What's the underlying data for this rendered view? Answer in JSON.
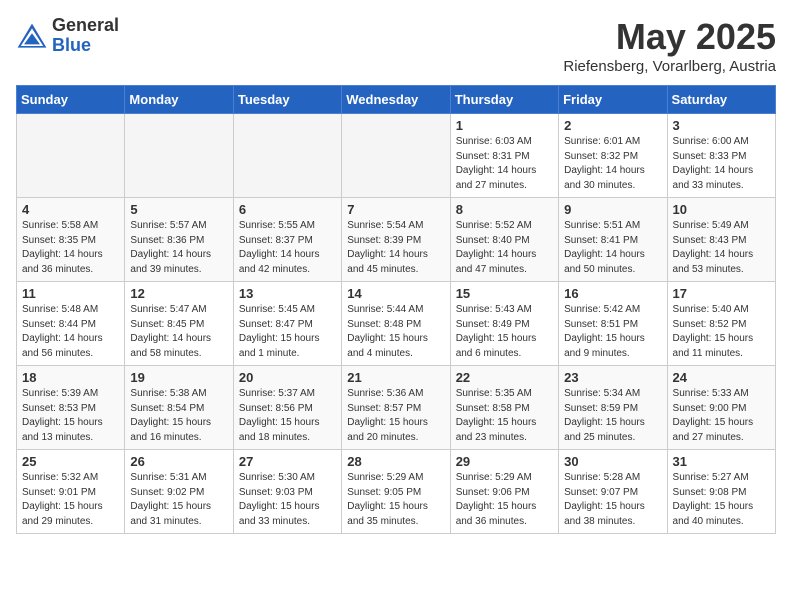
{
  "header": {
    "logo_general": "General",
    "logo_blue": "Blue",
    "title": "May 2025",
    "location": "Riefensberg, Vorarlberg, Austria"
  },
  "weekdays": [
    "Sunday",
    "Monday",
    "Tuesday",
    "Wednesday",
    "Thursday",
    "Friday",
    "Saturday"
  ],
  "weeks": [
    [
      {
        "day": "",
        "info": ""
      },
      {
        "day": "",
        "info": ""
      },
      {
        "day": "",
        "info": ""
      },
      {
        "day": "",
        "info": ""
      },
      {
        "day": "1",
        "info": "Sunrise: 6:03 AM\nSunset: 8:31 PM\nDaylight: 14 hours\nand 27 minutes."
      },
      {
        "day": "2",
        "info": "Sunrise: 6:01 AM\nSunset: 8:32 PM\nDaylight: 14 hours\nand 30 minutes."
      },
      {
        "day": "3",
        "info": "Sunrise: 6:00 AM\nSunset: 8:33 PM\nDaylight: 14 hours\nand 33 minutes."
      }
    ],
    [
      {
        "day": "4",
        "info": "Sunrise: 5:58 AM\nSunset: 8:35 PM\nDaylight: 14 hours\nand 36 minutes."
      },
      {
        "day": "5",
        "info": "Sunrise: 5:57 AM\nSunset: 8:36 PM\nDaylight: 14 hours\nand 39 minutes."
      },
      {
        "day": "6",
        "info": "Sunrise: 5:55 AM\nSunset: 8:37 PM\nDaylight: 14 hours\nand 42 minutes."
      },
      {
        "day": "7",
        "info": "Sunrise: 5:54 AM\nSunset: 8:39 PM\nDaylight: 14 hours\nand 45 minutes."
      },
      {
        "day": "8",
        "info": "Sunrise: 5:52 AM\nSunset: 8:40 PM\nDaylight: 14 hours\nand 47 minutes."
      },
      {
        "day": "9",
        "info": "Sunrise: 5:51 AM\nSunset: 8:41 PM\nDaylight: 14 hours\nand 50 minutes."
      },
      {
        "day": "10",
        "info": "Sunrise: 5:49 AM\nSunset: 8:43 PM\nDaylight: 14 hours\nand 53 minutes."
      }
    ],
    [
      {
        "day": "11",
        "info": "Sunrise: 5:48 AM\nSunset: 8:44 PM\nDaylight: 14 hours\nand 56 minutes."
      },
      {
        "day": "12",
        "info": "Sunrise: 5:47 AM\nSunset: 8:45 PM\nDaylight: 14 hours\nand 58 minutes."
      },
      {
        "day": "13",
        "info": "Sunrise: 5:45 AM\nSunset: 8:47 PM\nDaylight: 15 hours\nand 1 minute."
      },
      {
        "day": "14",
        "info": "Sunrise: 5:44 AM\nSunset: 8:48 PM\nDaylight: 15 hours\nand 4 minutes."
      },
      {
        "day": "15",
        "info": "Sunrise: 5:43 AM\nSunset: 8:49 PM\nDaylight: 15 hours\nand 6 minutes."
      },
      {
        "day": "16",
        "info": "Sunrise: 5:42 AM\nSunset: 8:51 PM\nDaylight: 15 hours\nand 9 minutes."
      },
      {
        "day": "17",
        "info": "Sunrise: 5:40 AM\nSunset: 8:52 PM\nDaylight: 15 hours\nand 11 minutes."
      }
    ],
    [
      {
        "day": "18",
        "info": "Sunrise: 5:39 AM\nSunset: 8:53 PM\nDaylight: 15 hours\nand 13 minutes."
      },
      {
        "day": "19",
        "info": "Sunrise: 5:38 AM\nSunset: 8:54 PM\nDaylight: 15 hours\nand 16 minutes."
      },
      {
        "day": "20",
        "info": "Sunrise: 5:37 AM\nSunset: 8:56 PM\nDaylight: 15 hours\nand 18 minutes."
      },
      {
        "day": "21",
        "info": "Sunrise: 5:36 AM\nSunset: 8:57 PM\nDaylight: 15 hours\nand 20 minutes."
      },
      {
        "day": "22",
        "info": "Sunrise: 5:35 AM\nSunset: 8:58 PM\nDaylight: 15 hours\nand 23 minutes."
      },
      {
        "day": "23",
        "info": "Sunrise: 5:34 AM\nSunset: 8:59 PM\nDaylight: 15 hours\nand 25 minutes."
      },
      {
        "day": "24",
        "info": "Sunrise: 5:33 AM\nSunset: 9:00 PM\nDaylight: 15 hours\nand 27 minutes."
      }
    ],
    [
      {
        "day": "25",
        "info": "Sunrise: 5:32 AM\nSunset: 9:01 PM\nDaylight: 15 hours\nand 29 minutes."
      },
      {
        "day": "26",
        "info": "Sunrise: 5:31 AM\nSunset: 9:02 PM\nDaylight: 15 hours\nand 31 minutes."
      },
      {
        "day": "27",
        "info": "Sunrise: 5:30 AM\nSunset: 9:03 PM\nDaylight: 15 hours\nand 33 minutes."
      },
      {
        "day": "28",
        "info": "Sunrise: 5:29 AM\nSunset: 9:05 PM\nDaylight: 15 hours\nand 35 minutes."
      },
      {
        "day": "29",
        "info": "Sunrise: 5:29 AM\nSunset: 9:06 PM\nDaylight: 15 hours\nand 36 minutes."
      },
      {
        "day": "30",
        "info": "Sunrise: 5:28 AM\nSunset: 9:07 PM\nDaylight: 15 hours\nand 38 minutes."
      },
      {
        "day": "31",
        "info": "Sunrise: 5:27 AM\nSunset: 9:08 PM\nDaylight: 15 hours\nand 40 minutes."
      }
    ]
  ]
}
